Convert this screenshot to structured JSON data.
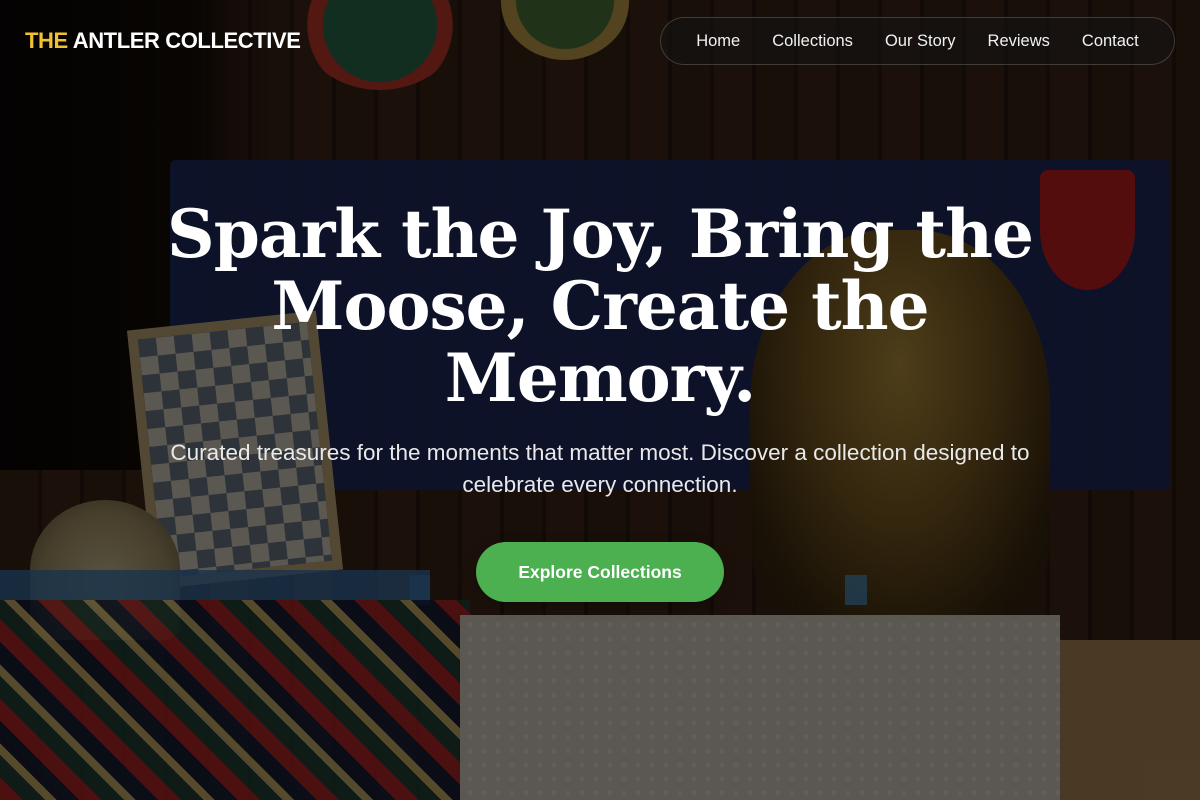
{
  "brand": {
    "accent": "THE",
    "rest": " ANTLER COLLECTIVE",
    "accent_color": "#f2c12e"
  },
  "nav": {
    "items": [
      {
        "label": "Home"
      },
      {
        "label": "Collections"
      },
      {
        "label": "Our Story"
      },
      {
        "label": "Reviews"
      },
      {
        "label": "Contact"
      }
    ]
  },
  "hero": {
    "title_line1": "Spark the Joy, Bring the",
    "title_line2": "Moose, Create the",
    "title_line3": "Memory.",
    "subtitle": "Curated treasures for the moments that matter most. Discover a collection designed to celebrate every connection.",
    "cta_label": "Explore Collections",
    "cta_color": "#4caf50"
  }
}
